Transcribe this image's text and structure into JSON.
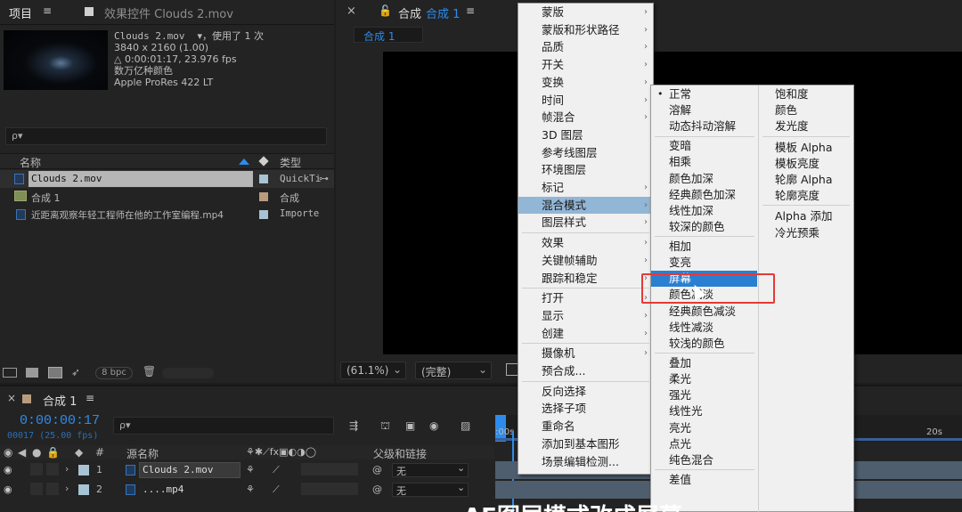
{
  "project_panel": {
    "tab_label": "项目",
    "effects_tab": "效果控件 Clouds 2.mov",
    "selected_file": "Clouds 2.mov",
    "used_count": "▾，使用了 1 次",
    "resolution": "3840 x 2160 (1.00)",
    "duration": "△ 0:00:01:17, 23.976 fps",
    "colors": "数万亿种颜色",
    "codec": "Apple ProRes 422 LT",
    "search_placeholder": "ρ▾",
    "col_name": "名称",
    "col_type": "类型",
    "items": [
      {
        "name": "Clouds 2.mov",
        "type": "QuickTi"
      },
      {
        "name": "合成 1",
        "type": "合成"
      },
      {
        "name": "近距离观察年轻工程师在他的工作室编程.mp4",
        "type": "Importe"
      }
    ],
    "bpc": "8 bpc"
  },
  "viewer": {
    "tab_prefix": "合成",
    "tab_name": "合成 1",
    "comp_tab": "合成 1",
    "zoom": "(61.1%)",
    "resolution": "(完整)"
  },
  "timeline": {
    "tab_label": "合成 1",
    "timecode": "0:00:00:17",
    "frame_info": "00017 (25.00 fps)",
    "search_placeholder": "ρ▾",
    "col_hash": "#",
    "col_source": "源名称",
    "col_parent": "父级和链接",
    "ruler_start": ":00s",
    "ruler_end": "20s",
    "layers": [
      {
        "num": "1",
        "name": "Clouds 2.mov",
        "parent": "无"
      },
      {
        "num": "2",
        "name": "....mp4",
        "parent": "无"
      }
    ]
  },
  "context_menu": {
    "items": [
      {
        "label": "蒙版",
        "sub": true
      },
      {
        "label": "蒙版和形状路径",
        "sub": true
      },
      {
        "label": "品质",
        "sub": true
      },
      {
        "label": "开关",
        "sub": true
      },
      {
        "label": "变换",
        "sub": true
      },
      {
        "label": "时间",
        "sub": true
      },
      {
        "label": "帧混合",
        "sub": true
      },
      {
        "label": "3D 图层",
        "sub": false
      },
      {
        "label": "参考线图层",
        "sub": false
      },
      {
        "label": "环境图层",
        "sub": false
      },
      {
        "label": "标记",
        "sub": true
      },
      {
        "label": "混合模式",
        "sub": true
      },
      {
        "label": "图层样式",
        "sub": true
      },
      {
        "label": "效果",
        "sub": true
      },
      {
        "label": "关键帧辅助",
        "sub": true
      },
      {
        "label": "跟踪和稳定",
        "sub": true
      },
      {
        "label": "打开",
        "sub": true
      },
      {
        "label": "显示",
        "sub": true
      },
      {
        "label": "创建",
        "sub": true
      },
      {
        "label": "摄像机",
        "sub": true
      },
      {
        "label": "预合成...",
        "sub": false
      },
      {
        "label": "反向选择",
        "sub": false
      },
      {
        "label": "选择子项",
        "sub": false
      },
      {
        "label": "重命名",
        "sub": false
      },
      {
        "label": "添加到基本图形",
        "sub": false
      },
      {
        "label": "场景编辑检测...",
        "sub": false
      }
    ]
  },
  "blend_menu": {
    "col1": [
      "正常",
      "溶解",
      "动态抖动溶解",
      "变暗",
      "相乘",
      "颜色加深",
      "经典颜色加深",
      "线性加深",
      "较深的颜色",
      "相加",
      "变亮",
      "屏幕",
      "颜色减淡",
      "经典颜色减淡",
      "线性减淡",
      "较浅的颜色",
      "叠加",
      "柔光",
      "强光",
      "线性光",
      "亮光",
      "点光",
      "纯色混合",
      "差值"
    ],
    "col2": [
      "饱和度",
      "颜色",
      "发光度",
      "模板 Alpha",
      "模板亮度",
      "轮廓 Alpha",
      "轮廓亮度",
      "Alpha 添加",
      "冷光预乘"
    ]
  },
  "caption": "AE图层模式改成屏幕"
}
